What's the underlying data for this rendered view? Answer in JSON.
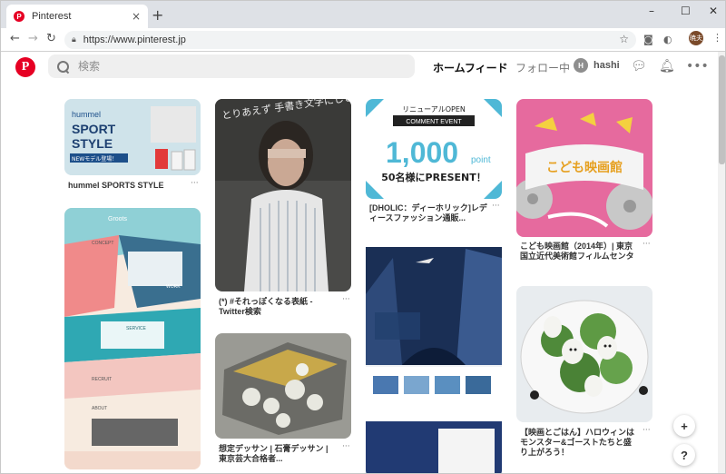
{
  "browser": {
    "tab_title": "Pinterest",
    "tab_favicon": "P",
    "tab_close": "×",
    "new_tab": "+",
    "window_controls": [
      "–",
      "☐",
      "✕"
    ],
    "url": "https://www.pinterest.jp",
    "profile_initials": "暁夫"
  },
  "header": {
    "logo": "P",
    "search_placeholder": "検索",
    "home_label": "ホームフィード",
    "following_label": "フォロー中",
    "user_initial": "H",
    "user_name": "hashi"
  },
  "pins": [
    {
      "title": "hummel SPORTS STYLE",
      "more": "···",
      "brand": "hummel",
      "headline": "SPORT STYLE",
      "tag": "NEWモデル登場！"
    },
    {
      "title": "(*) #それっぽくなる表紙 - Twitter検索",
      "more": "···",
      "overlay": "とりあえず 手書き文字にしとけば それっぽく なる。"
    },
    {
      "title": "想定デッサン | 石膏デッサン | 東京芸大合格者...",
      "more": "···"
    },
    {
      "title": "[DHOLIC：ディーホリック]レディースファッション通販...",
      "more": "···",
      "ribbon": "リニューアルOPEN",
      "event": "COMMENT EVENT",
      "big": "1,000",
      "unit": "point",
      "present": "50名様にPRESENT！"
    },
    {
      "title": "",
      "more": ""
    },
    {
      "title": "こども映画館（2014年）| 東京国立近代美術館フィルムセンタ",
      "more": "···",
      "poster": "こども映画館"
    },
    {
      "title": "【映画とごはん】ハロウィンはモンスター&ゴーストたちと盛り上がろう！",
      "more": "···"
    },
    {
      "title": "",
      "more": "",
      "brand": "Groots",
      "sections": [
        "CONCEPT",
        "WORK",
        "SERVICE",
        "RECRUIT",
        "ABOUT"
      ]
    }
  ],
  "fab": {
    "add": "+",
    "help": "?"
  }
}
